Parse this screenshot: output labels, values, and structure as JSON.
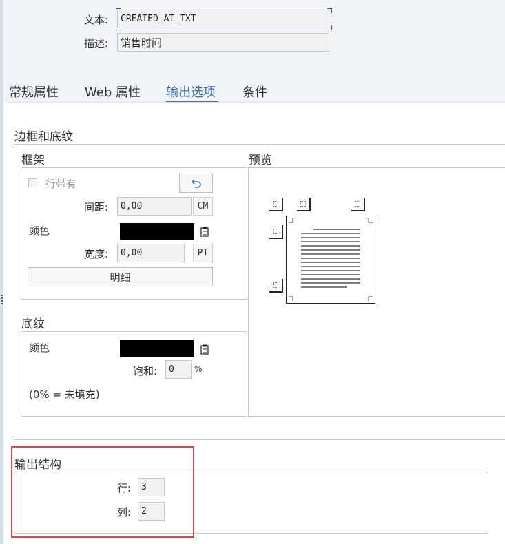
{
  "header": {
    "text_label": "文本:",
    "text_value": "CREATED_AT_TXT",
    "desc_label": "描述:",
    "desc_value": "销售时间"
  },
  "tabs": [
    {
      "label": "常规属性",
      "active": false
    },
    {
      "label": "Web 属性",
      "active": false
    },
    {
      "label": "输出选项",
      "active": true
    },
    {
      "label": "条件",
      "active": false
    }
  ],
  "border_shading": {
    "title": "边框和底纹",
    "frame": {
      "title": "框架",
      "row_checkbox_label": "行带有",
      "spacing_label": "间距:",
      "spacing_value": "0,00",
      "spacing_unit": "CM",
      "color_label": "颜色",
      "width_label": "宽度:",
      "width_value": "0,00",
      "width_unit": "PT",
      "detail_button": "明细"
    },
    "preview": {
      "title": "预览"
    },
    "shading": {
      "title": "底纹",
      "color_label": "颜色",
      "saturation_label": "饱和:",
      "saturation_value": "0",
      "saturation_unit": "%",
      "note": "(0% = 未填充)"
    }
  },
  "output_structure": {
    "title": "输出结构",
    "rows_label": "行:",
    "rows_value": "3",
    "cols_label": "列:",
    "cols_value": "2"
  },
  "colors": {
    "accent": "#3b6fa8",
    "highlight": "#e04444",
    "swatch": "#000000"
  }
}
